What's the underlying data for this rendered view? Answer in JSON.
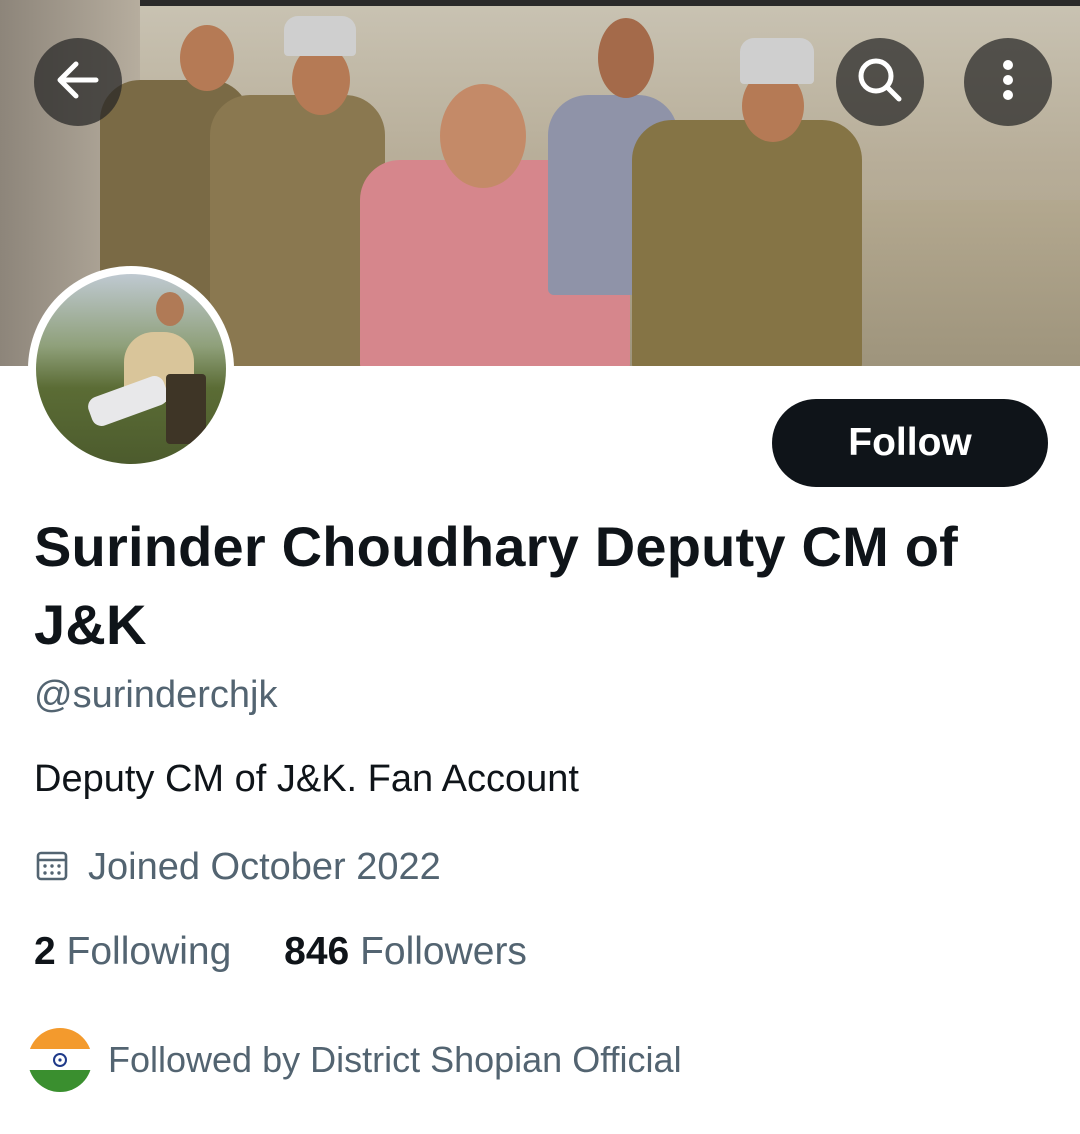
{
  "header": {
    "back_icon": "arrow-left-icon",
    "search_icon": "search-icon",
    "more_icon": "more-vertical-icon"
  },
  "profile": {
    "display_name": "Surinder Choudhary Deputy CM of J&K",
    "handle": "@surinderchjk",
    "bio": "Deputy CM of J&K. Fan Account",
    "joined": "Joined October 2022",
    "following_count": "2",
    "following_label": "Following",
    "followers_count": "846",
    "followers_label": "Followers",
    "followed_by": "Followed by District Shopian Official"
  },
  "actions": {
    "follow_label": "Follow"
  },
  "colors": {
    "text_primary": "#0f1419",
    "text_secondary": "#536471",
    "follow_button_bg": "#0f1419",
    "follow_button_text": "#ffffff"
  }
}
